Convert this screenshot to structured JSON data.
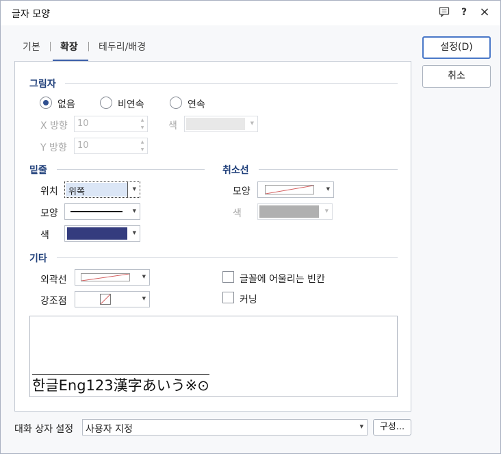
{
  "window": {
    "title": "글자 모양",
    "help_icon": "?",
    "close_icon": "×"
  },
  "tabs": [
    {
      "label": "기본",
      "active": false
    },
    {
      "label": "확장",
      "active": true
    },
    {
      "label": "테두리/배경",
      "active": false
    }
  ],
  "buttons": {
    "ok": "설정(D)",
    "cancel": "취소"
  },
  "shadow": {
    "title": "그림자",
    "options": [
      {
        "label": "없음",
        "checked": true
      },
      {
        "label": "비연속",
        "checked": false
      },
      {
        "label": "연속",
        "checked": false
      }
    ],
    "x_label": "X 방향",
    "x_value": "10",
    "y_label": "Y 방향",
    "y_value": "10",
    "color_label": "색"
  },
  "underline": {
    "title": "밑줄",
    "position_label": "위치",
    "position_value": "위쪽",
    "shape_label": "모양",
    "color_label": "색",
    "color": "#343c7e"
  },
  "strikeout": {
    "title": "취소선",
    "shape_label": "모양",
    "color_label": "색",
    "color": "#b0b0b0"
  },
  "other": {
    "title": "기타",
    "outline_label": "외곽선",
    "emphasis_label": "강조점",
    "checkbox1_label": "글꼴에 어울리는 빈칸",
    "checkbox2_label": "커닝"
  },
  "preview": {
    "sample_text": "한글Eng123漢字あいう※⊙"
  },
  "footer": {
    "label": "대화 상자 설정",
    "value": "사용자 지정",
    "compose_button": "구성..."
  }
}
